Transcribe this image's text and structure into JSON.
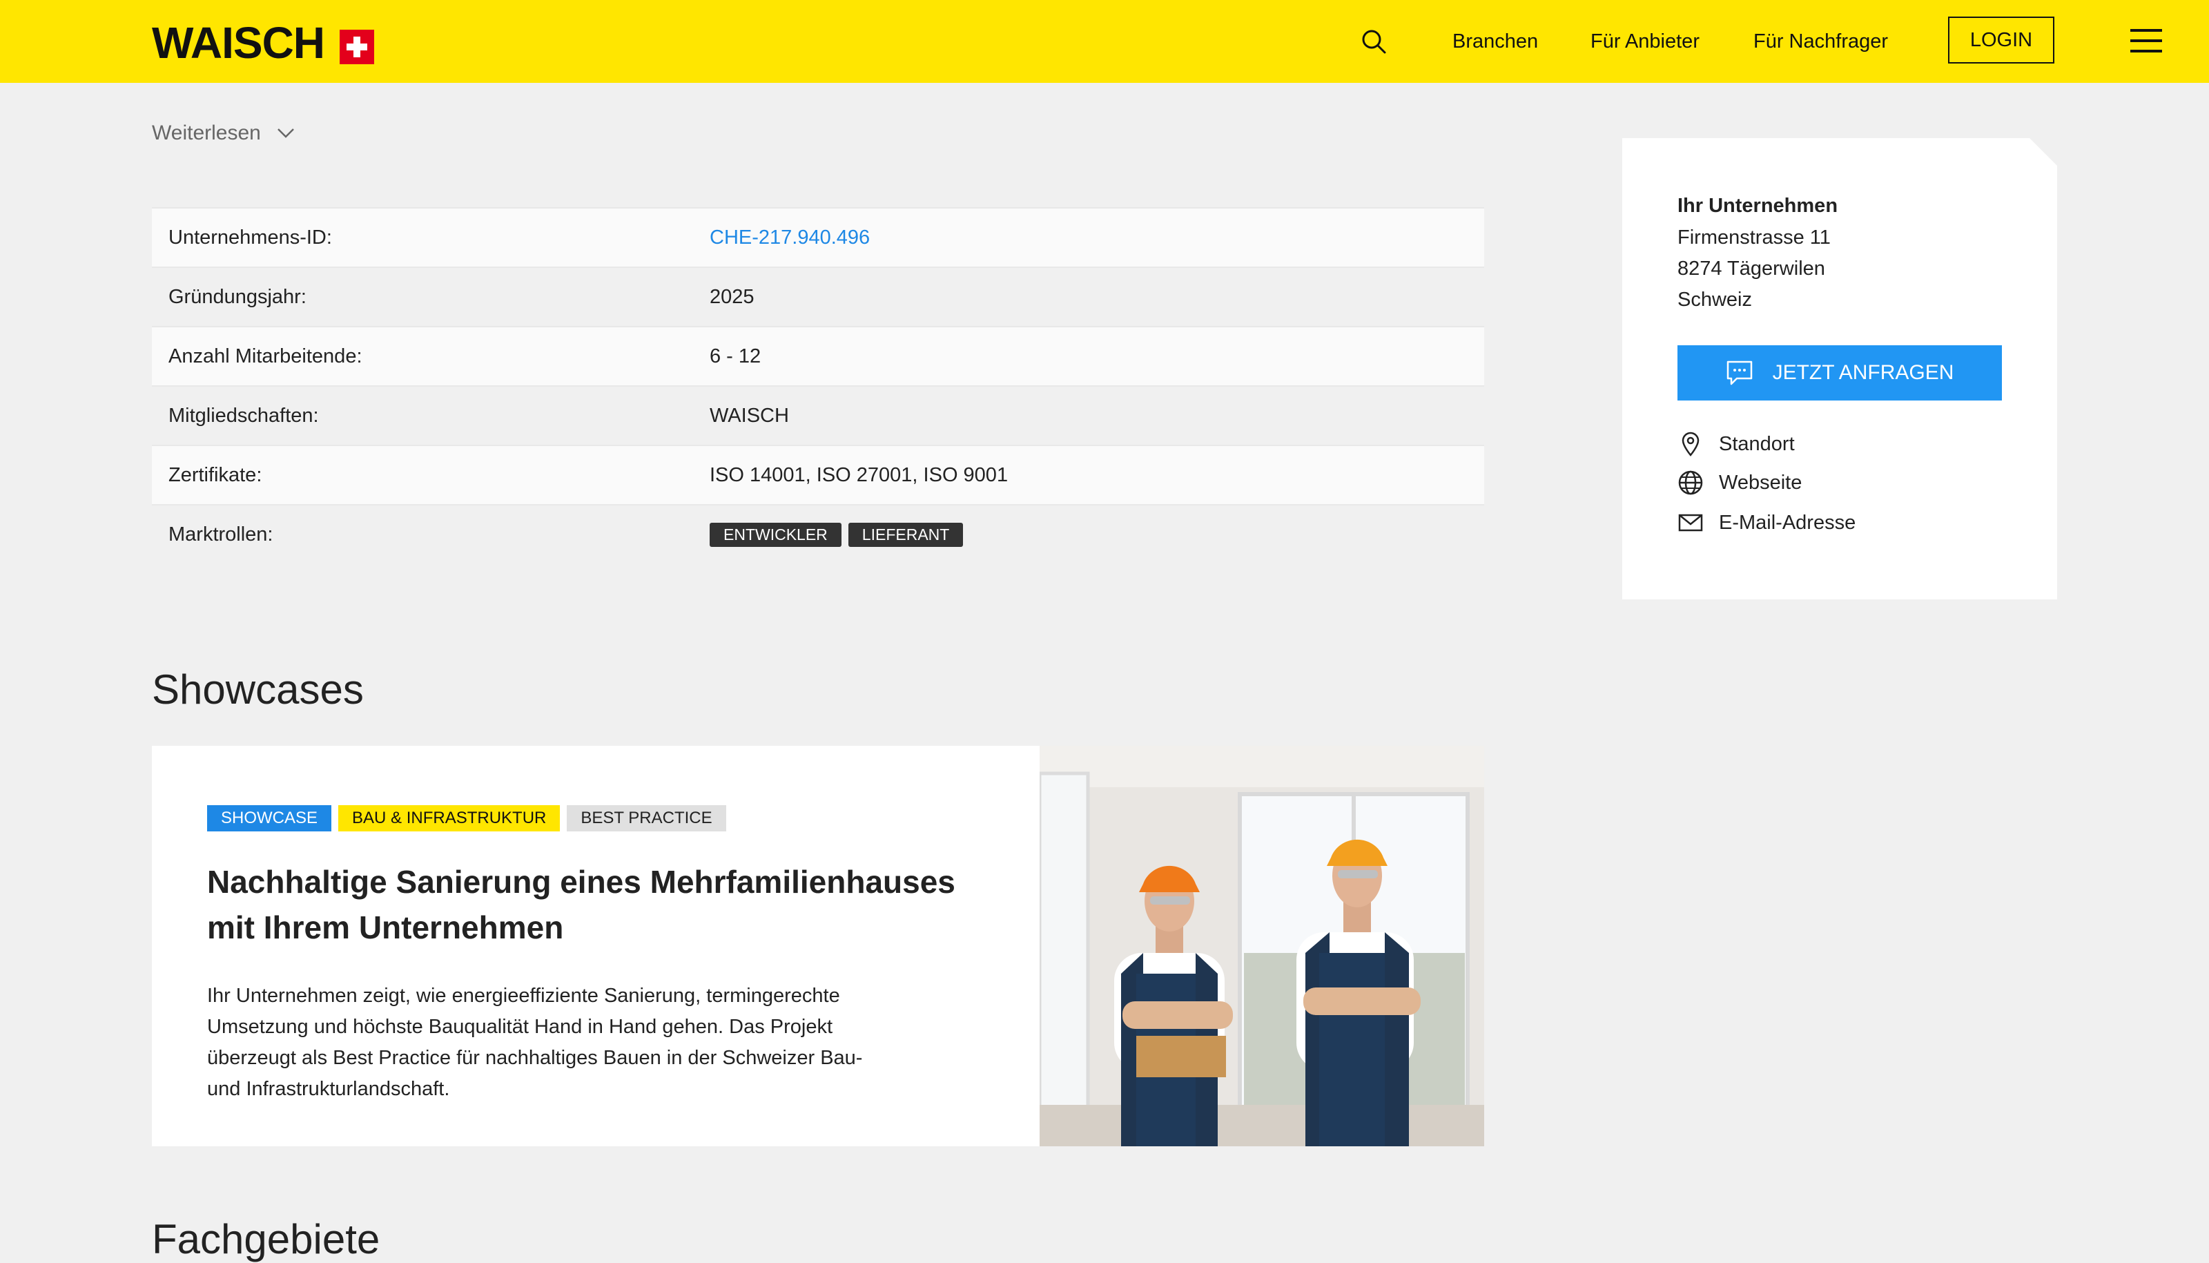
{
  "header": {
    "logo_text": "WAISCH",
    "nav": [
      "Branchen",
      "Für Anbieter",
      "Für Nachfrager"
    ],
    "login": "LOGIN"
  },
  "readmore": "Weiterlesen",
  "info_rows": [
    {
      "label": "Unternehmens-ID:",
      "value": "CHE-217.940.496"
    },
    {
      "label": "Gründungsjahr:",
      "value": "2025"
    },
    {
      "label": "Anzahl Mitarbeitende:",
      "value": "6 - 12"
    },
    {
      "label": "Mitgliedschaften:",
      "value": "WAISCH"
    },
    {
      "label": "Zertifikate:",
      "value": "ISO 14001, ISO 27001, ISO 9001"
    },
    {
      "label": "Marktrollen:",
      "tags": [
        "ENTWICKLER",
        "LIEFERANT"
      ]
    }
  ],
  "sidebar": {
    "company": "Ihr Unternehmen",
    "address": [
      "Firmenstrasse 11",
      "8274 Tägerwilen",
      "Schweiz"
    ],
    "cta": "JETZT ANFRAGEN",
    "links": [
      {
        "label": "Standort",
        "icon": "location-pin-icon"
      },
      {
        "label": "Webseite",
        "icon": "globe-icon"
      },
      {
        "label": "E-Mail-Adresse",
        "icon": "mail-icon"
      }
    ]
  },
  "showcases": {
    "title": "Showcases",
    "card": {
      "tags": [
        "SHOWCASE",
        "BAU & INFRASTRUKTUR",
        "BEST PRACTICE"
      ],
      "title": "Nachhaltige Sanierung eines Mehrfamilienhauses mit Ihrem Unternehmen",
      "description": "Ihr Unternehmen zeigt, wie energieeffiziente Sanierung, termingerechte Umsetzung und höchste Bauqualität Hand in Hand gehen. Das Projekt überzeugt als Best Practice für nachhaltiges Bauen in der Schweizer Bau- und Infrastrukturlandschaft.",
      "image": "two-construction-workers-photo"
    }
  },
  "next_section_title": "Fachgebiete",
  "colors": {
    "header_yellow": "#ffe600",
    "accent_blue": "#2196f3",
    "swiss_red": "#e3001b",
    "tag_dark": "#333333"
  }
}
